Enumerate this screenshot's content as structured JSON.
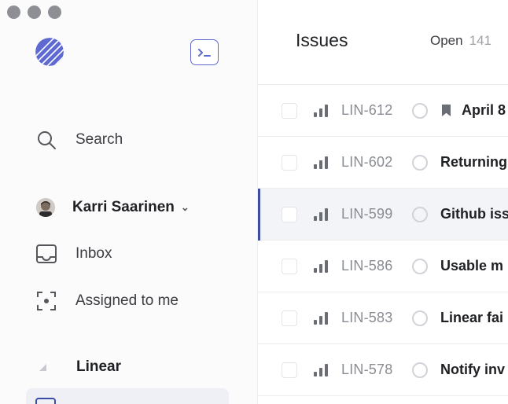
{
  "sidebar": {
    "search_label": "Search",
    "user_name": "Karri Saarinen",
    "inbox_label": "Inbox",
    "assigned_label": "Assigned to me",
    "team_label": "Linear"
  },
  "header": {
    "title": "Issues",
    "tab_open_label": "Open",
    "tab_open_count": "141"
  },
  "issues": [
    {
      "id": "LIN-612",
      "title": "April 8"
    },
    {
      "id": "LIN-602",
      "title": "Returning"
    },
    {
      "id": "LIN-599",
      "title": "Github iss"
    },
    {
      "id": "LIN-586",
      "title": "Usable m"
    },
    {
      "id": "LIN-583",
      "title": "Linear fai"
    },
    {
      "id": "LIN-578",
      "title": "Notify inv"
    }
  ],
  "colors": {
    "accent": "#5e6ad2",
    "selected_bar": "#3d4da6",
    "sidebar_bg": "#fbfbfc"
  }
}
